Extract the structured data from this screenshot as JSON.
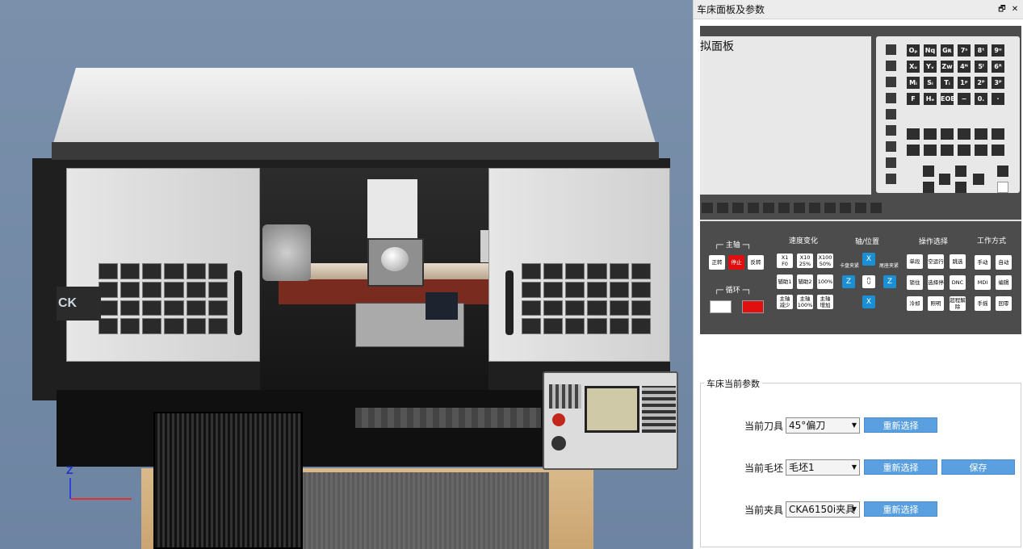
{
  "viewport": {
    "machine_plate": "CK",
    "axis_label": "Z"
  },
  "side": {
    "title": "车床面板及参数",
    "restore_icon": "🗗",
    "close_icon": "✕"
  },
  "panel": {
    "screen_label": "拟面板",
    "keypad_keys": [
      "Oₚ",
      "Nq",
      "Gʀ",
      "7ˢ",
      "8ᵗ",
      "9ᵘ",
      "Xᵤ",
      "Yᵥ",
      "Zw",
      "4ᴺ",
      "5ˡ",
      "6ᴿ",
      "Mᵢ",
      "Sᵢ",
      "Tᵢ",
      "1ᵖ",
      "2ᴾ",
      "3ᴾ",
      "F",
      "Hₑ",
      "EOB",
      "−",
      "0.",
      "·"
    ],
    "groups": {
      "spindle": "主轴",
      "speed": "速度变化",
      "axis": "轴/位置",
      "operation": "操作选择",
      "mode": "工作方式",
      "cycle": "循环"
    },
    "spindle_buttons": [
      "正转",
      "停止",
      "反转"
    ],
    "speed_buttons": [
      "X1\nF0",
      "X10\n25%",
      "X100\n50%",
      "辅助1",
      "辅助2",
      "100%",
      "主轴\n减少",
      "主轴\n100%",
      "主轴\n增加"
    ],
    "axis_buttons": {
      "x_up": "X",
      "z_left": "Z",
      "center": "⩇",
      "z_right": "Z",
      "x_down": "X",
      "chuck": "卡盘夹紧",
      "tail": "尾座夹紧"
    },
    "operation_buttons": [
      "单段",
      "空运行",
      "跳选",
      "锁住",
      "选择停",
      "DNC",
      "冷却",
      "照明",
      "超程解除"
    ],
    "mode_buttons": [
      "手动",
      "自动",
      "MDI",
      "编辑",
      "手摇",
      "回零"
    ]
  },
  "params": {
    "legend": "车床当前参数",
    "rows": [
      {
        "label": "当前刀具",
        "value": "45°偏刀",
        "button": "重新选择"
      },
      {
        "label": "当前毛坯",
        "value": "毛坯1",
        "button": "重新选择",
        "extra": "保存"
      },
      {
        "label": "当前夹具",
        "value": "CKA6150i夹具",
        "button": "重新选择"
      }
    ]
  },
  "colors": {
    "accent": "#5aa0e0",
    "panel_bg": "#4c4c4c",
    "stop_red": "#e01010",
    "axis_blue": "#1a8fd3"
  }
}
